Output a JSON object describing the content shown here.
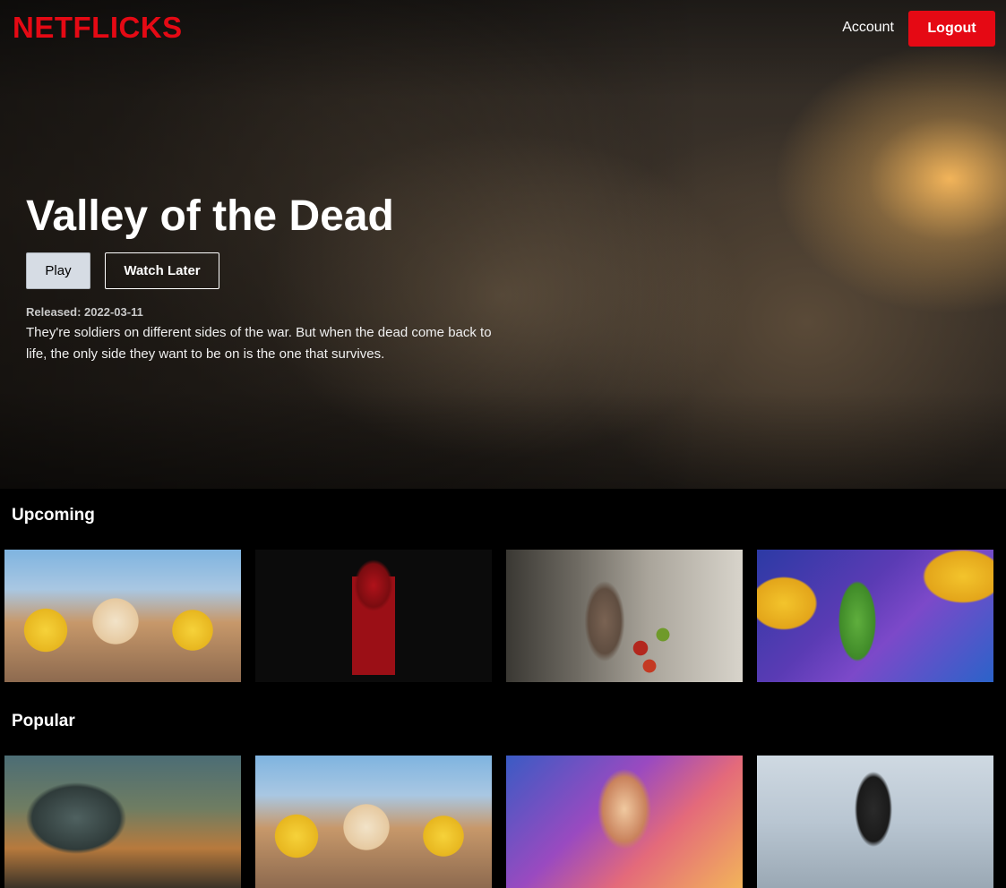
{
  "brand": {
    "logo": "NETFLICKS",
    "accent_color": "#e50914"
  },
  "nav": {
    "account_label": "Account",
    "logout_label": "Logout"
  },
  "hero": {
    "title": "Valley of the Dead",
    "play_label": "Play",
    "watch_later_label": "Watch Later",
    "release_text": "Released: 2022-03-11",
    "overview": "They're soldiers on different sides of the war. But when the dead come back to life, the only side they want to be on is the one that survives."
  },
  "sections": [
    {
      "title": "Upcoming",
      "movies": [
        {
          "poster": "minions-backdrop"
        },
        {
          "poster": "red-devil-backdrop"
        },
        {
          "poster": "apple-cart-backdrop"
        },
        {
          "poster": "dragon-ball-backdrop"
        }
      ]
    },
    {
      "title": "Popular",
      "movies": [
        {
          "poster": "dinosaur-backdrop"
        },
        {
          "poster": "minions-backdrop"
        },
        {
          "poster": "thor-backdrop"
        },
        {
          "poster": "fighter-jet-backdrop"
        }
      ]
    }
  ]
}
